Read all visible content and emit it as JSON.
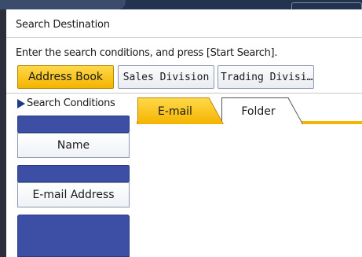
{
  "window": {
    "title": "Search Destination"
  },
  "instruction": "Enter the search conditions, and press [Start Search].",
  "destinations": [
    {
      "label": "Address Book",
      "active": true
    },
    {
      "label": "Sales Division",
      "active": false
    },
    {
      "label": "Trading Divisi…",
      "active": false
    }
  ],
  "search_conditions": {
    "label": "Search Conditions",
    "fields": [
      {
        "label": "Name"
      },
      {
        "label": "E-mail Address"
      }
    ]
  },
  "tabs": [
    {
      "label": "E-mail",
      "active": true
    },
    {
      "label": "Folder",
      "active": false
    }
  ],
  "colors": {
    "accent": "#f4b400",
    "panel_blue": "#3c4fa5",
    "header_dark": "#23324f"
  }
}
